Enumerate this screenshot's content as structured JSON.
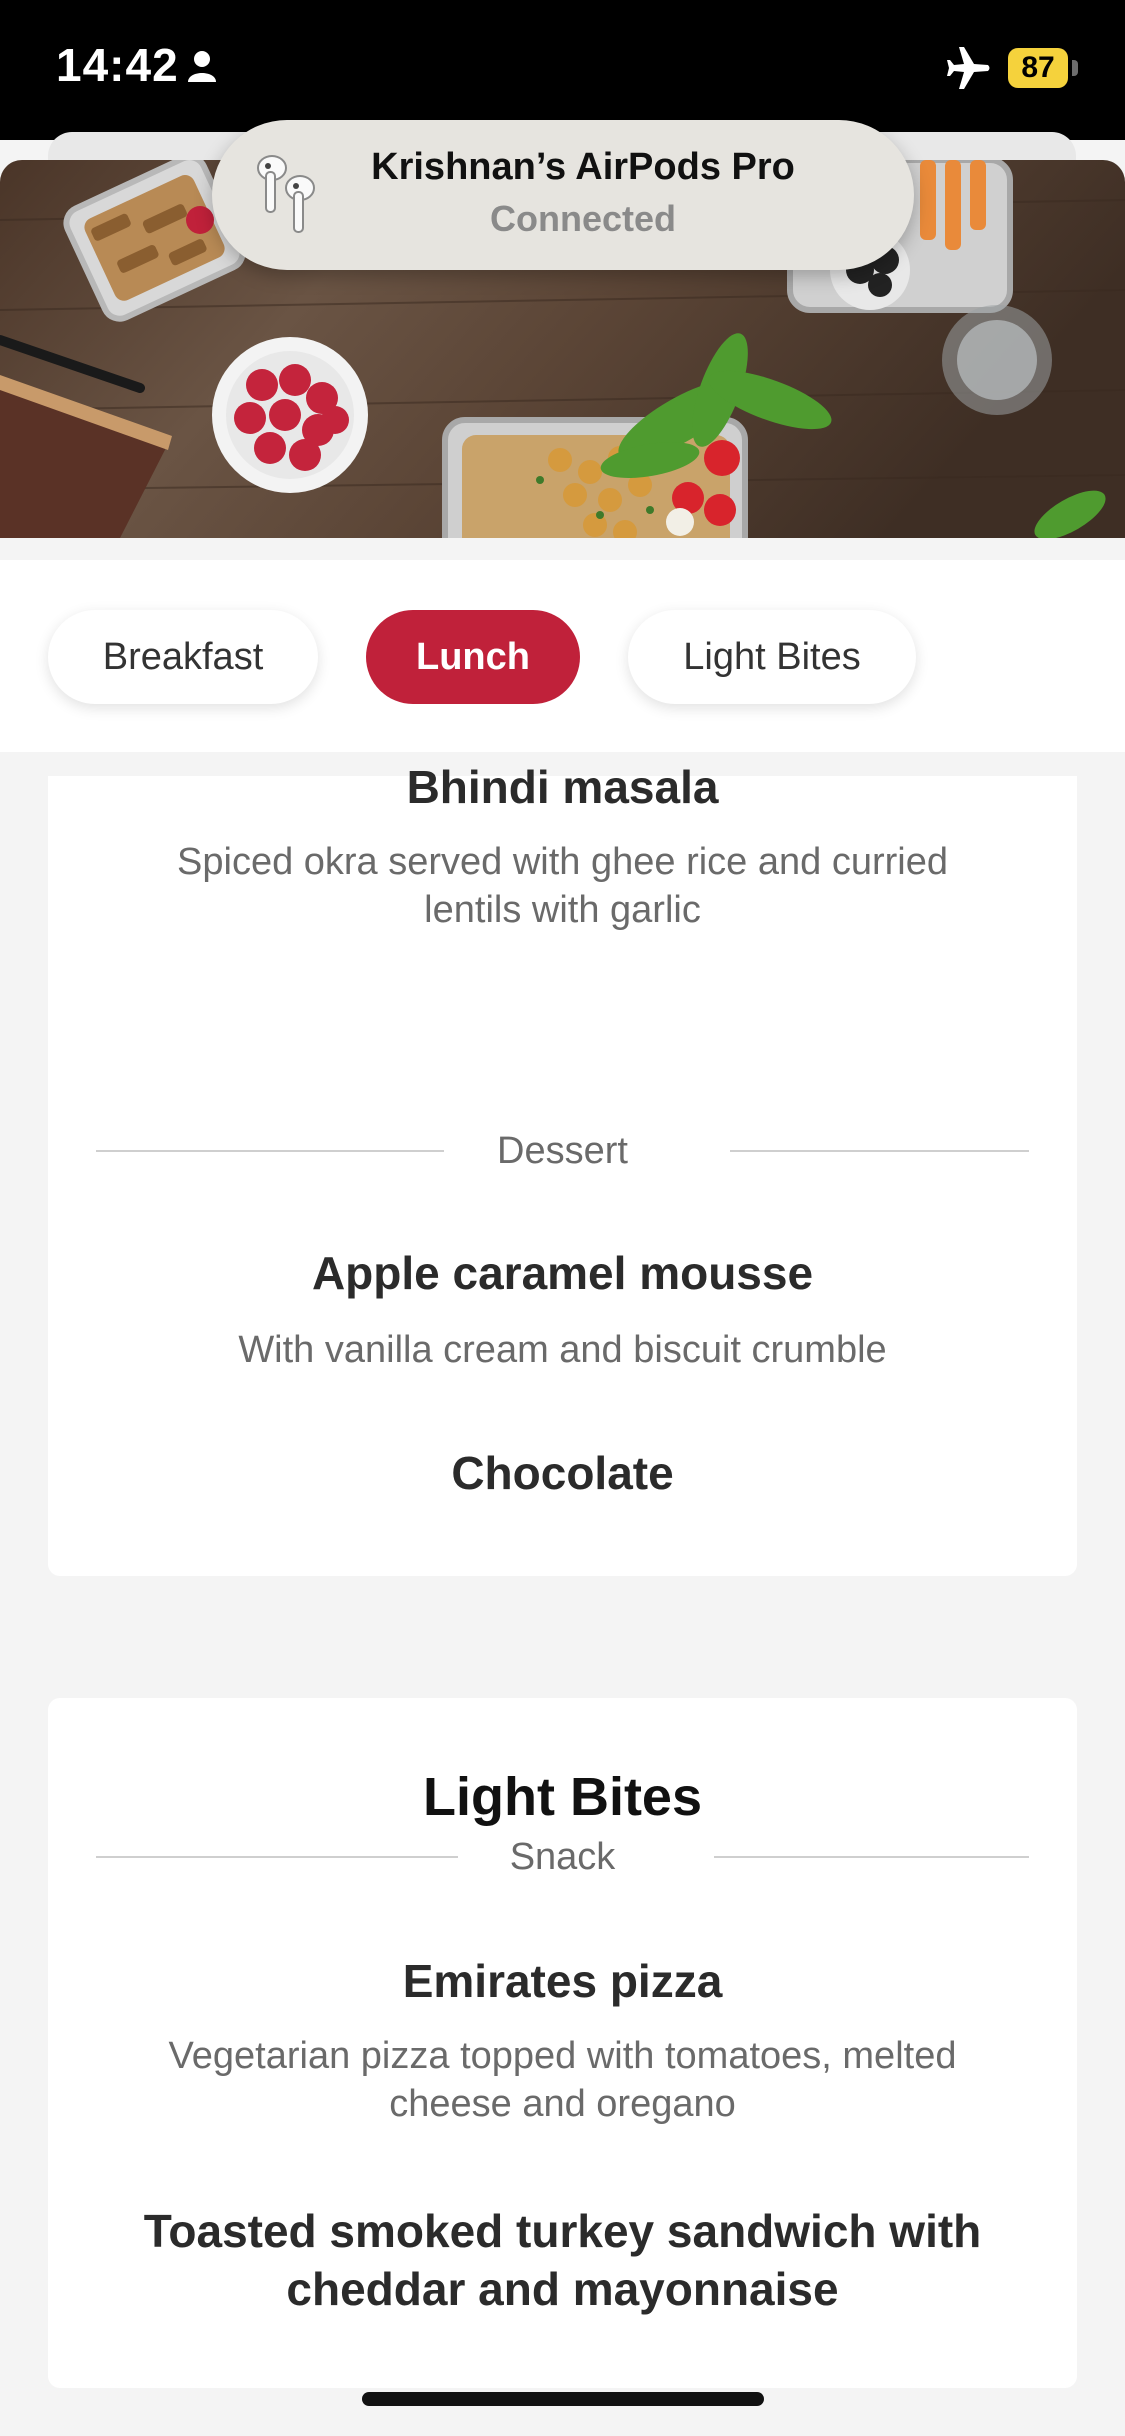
{
  "status_bar": {
    "time": "14:42",
    "battery": "87",
    "icons": [
      "person-icon",
      "airplane-icon",
      "battery-icon"
    ]
  },
  "airpods": {
    "device": "Krishnan’s AirPods Pro",
    "status": "Connected",
    "icon": "airpods-icon"
  },
  "tabs": [
    {
      "label": "Breakfast",
      "active": false
    },
    {
      "label": "Lunch",
      "active": true
    },
    {
      "label": "Light Bites",
      "active": false
    }
  ],
  "lunch": {
    "main_dish": {
      "name": "Bhindi masala",
      "description_line1": "Spiced okra served with ghee rice and curried",
      "description_line2": "lentils with garlic"
    },
    "dessert_label": "Dessert",
    "desserts": [
      {
        "name": "Apple caramel mousse",
        "description": "With vanilla cream and biscuit crumble"
      },
      {
        "name": "Chocolate",
        "description": ""
      }
    ]
  },
  "light_bites": {
    "title": "Light Bites",
    "category": "Snack",
    "items": [
      {
        "name": "Emirates pizza",
        "description_line1": "Vegetarian pizza topped with tomatoes, melted",
        "description_line2": "cheese and oregano"
      },
      {
        "name_line1": "Toasted smoked turkey sandwich with",
        "name_line2": "cheddar and mayonnaise"
      }
    ]
  },
  "colors": {
    "accent": "#c0213a",
    "status_bar_bg": "#000000",
    "battery": "#f5d23c",
    "page_bg": "#f4f4f4"
  }
}
